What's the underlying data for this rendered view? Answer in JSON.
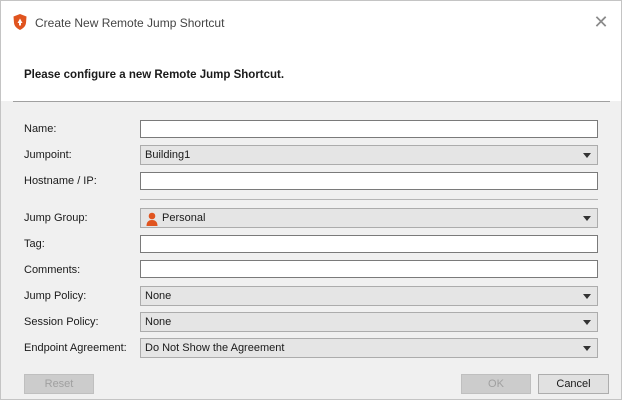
{
  "window": {
    "title": "Create New Remote Jump Shortcut",
    "icon": "shield-icon",
    "accent_color": "#e0541f"
  },
  "header": {
    "text": "Please configure a new Remote Jump Shortcut."
  },
  "form": {
    "name": {
      "label": "Name:",
      "value": ""
    },
    "jumpoint": {
      "label": "Jumpoint:",
      "value": "Building1"
    },
    "hostname": {
      "label": "Hostname / IP:",
      "value": ""
    },
    "jump_group": {
      "label": "Jump Group:",
      "value": "Personal",
      "icon": "person-icon"
    },
    "tag": {
      "label": "Tag:",
      "value": ""
    },
    "comments": {
      "label": "Comments:",
      "value": ""
    },
    "jump_policy": {
      "label": "Jump Policy:",
      "value": "None"
    },
    "session_policy": {
      "label": "Session Policy:",
      "value": "None"
    },
    "endpoint_agreement": {
      "label": "Endpoint Agreement:",
      "value": "Do Not Show the Agreement"
    }
  },
  "buttons": {
    "reset": "Reset",
    "ok": "OK",
    "cancel": "Cancel"
  }
}
